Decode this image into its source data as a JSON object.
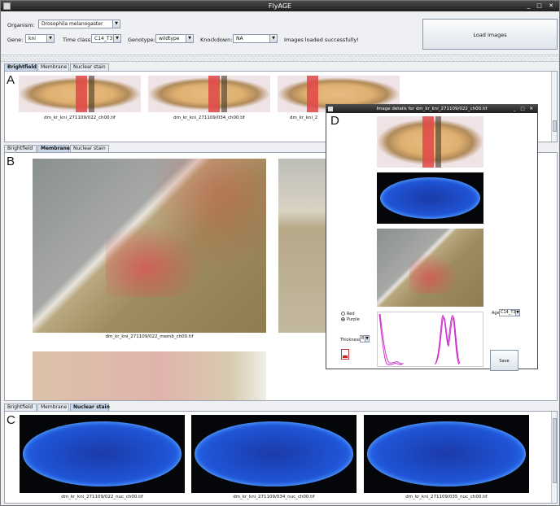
{
  "window": {
    "title": "FlyAGE",
    "controls": "_ □ ✕"
  },
  "toolbar": {
    "organism_label": "Organism:",
    "organism_value": "Drosophila melanogaster",
    "gene_label": "Gene:",
    "gene_value": "kni",
    "time_class_label": "Time class:",
    "time_class_value": "C14_T3",
    "genotype_label": "Genotype:",
    "genotype_value": "wildtype",
    "knockdown_label": "Knockdown:",
    "knockdown_value": "NA",
    "status": "Images loaded successfully!",
    "load_button": "Load images"
  },
  "tabs": [
    "Brightfield",
    "Membrane",
    "Nuclear stain"
  ],
  "panels": {
    "a": {
      "letter": "A",
      "selected_tab": 0,
      "captions": [
        "dm_kr_kni_271109/022_ch00.tif",
        "dm_kr_kni_271109/034_ch00.tif",
        "dm_kr_kni_2"
      ]
    },
    "b": {
      "letter": "B",
      "selected_tab": 1,
      "captions": [
        "dm_kr_kni_271109/022_memb_ch00.tif"
      ]
    },
    "c": {
      "letter": "C",
      "selected_tab": 2,
      "captions": [
        "dm_kr_kni_271109/022_nuc_ch00.tif",
        "dm_kr_kni_271109/034_nuc_ch00.tif",
        "dm_kr_kni_271109/035_nuc_ch00.tif"
      ]
    }
  },
  "dialog": {
    "title": "Image details for dm_kr_kni_271109/022_ch00.tif",
    "controls": "_ □ ✕",
    "letter": "D",
    "radio_red": "Red",
    "radio_purple": "Purple",
    "thickness_label": "Thickness:",
    "thickness_value": "8",
    "age_label": "Age:",
    "age_value": "C14_T3",
    "save_button": "Save"
  },
  "colors": {
    "title_bar": "#1e1e1e",
    "selected_tab": "#c9d8ea",
    "nuclear_blue": "#1f54d6",
    "stripe_red": "#e0544d",
    "plot_curve": "#cc33cc"
  },
  "icons": [
    "app-icon",
    "dropdown-arrow-icon",
    "pdf-icon"
  ]
}
